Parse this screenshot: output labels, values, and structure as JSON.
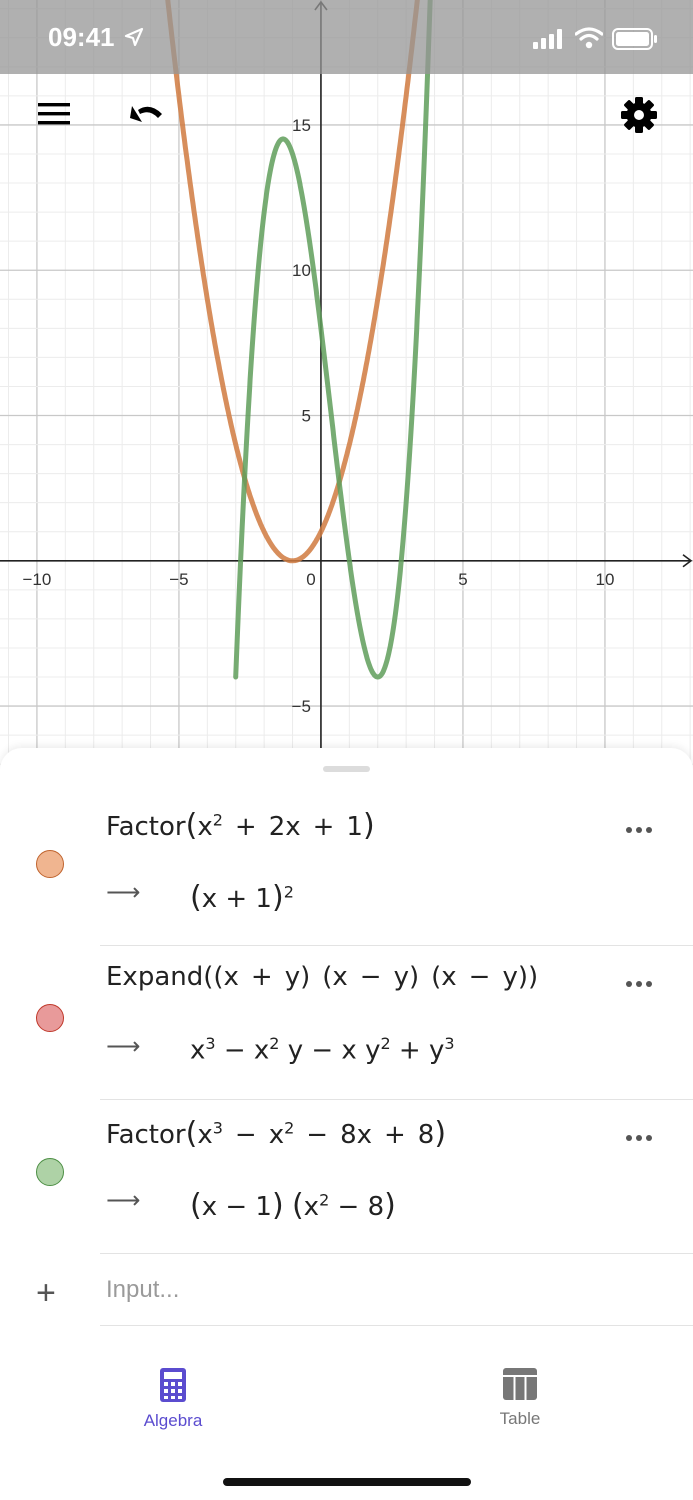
{
  "status_bar": {
    "time": "09:41"
  },
  "graph": {
    "x_range": [
      -11.3,
      13.1
    ],
    "y_range": [
      -7.2,
      19.3
    ],
    "x_ticks": [
      -10,
      -5,
      0,
      5,
      10
    ],
    "y_ticks": [
      -5,
      5,
      10,
      15
    ],
    "x_tick_labels": [
      "−10",
      "−5",
      "0",
      "5",
      "10"
    ],
    "y_tick_labels": [
      "−5",
      "5",
      "10",
      "15"
    ],
    "curves": [
      {
        "name": "(x + 1)^2",
        "color": "#d07a3f",
        "samples_x": [
          -10,
          -5.4,
          -5,
          -4,
          -3,
          -2,
          -1,
          0,
          1,
          2,
          3,
          3.4
        ]
      },
      {
        "name": "(x − 1)(x^2 − 8)",
        "color": "#5f9e5a",
        "samples_x": [
          -3,
          -2.83,
          -2,
          -1.55,
          -1,
          0,
          1,
          1.88,
          2,
          2.83,
          3,
          4
        ]
      }
    ]
  },
  "algebra": {
    "rows": [
      {
        "command": "Factor",
        "input_text": "Factor(x2 + 2x + 1)",
        "output_text": "(x + 1)2",
        "dot_color": "#f0b590",
        "dot_border": "#c0632d"
      },
      {
        "command": "Expand",
        "input_text": "Expand((x + y) (x − y) (x − y))",
        "output_text": "x3 − x2 y − x y2 + y3",
        "dot_color": "#e89a9a",
        "dot_border": "#c0392b"
      },
      {
        "command": "Factor",
        "input_text": "Factor(x3 − x2 − 8x + 8)",
        "output_text": "(x − 1) (x2 − 8)",
        "dot_color": "#aed2a6",
        "dot_border": "#4d8f45"
      }
    ],
    "input_placeholder": "Input..."
  },
  "tabs": [
    {
      "label": "Algebra",
      "icon": "calculator-icon",
      "active": true,
      "color": "#5b4ccf"
    },
    {
      "label": "Table",
      "icon": "table-icon",
      "active": false,
      "color": "#777777"
    }
  ]
}
